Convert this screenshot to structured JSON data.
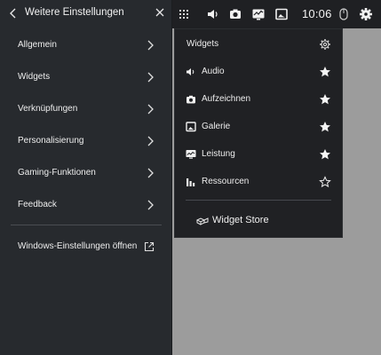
{
  "settings_panel": {
    "title": "Weitere Einstellungen",
    "items": [
      {
        "label": "Allgemein"
      },
      {
        "label": "Widgets"
      },
      {
        "label": "Verknüpfungen"
      },
      {
        "label": "Personalisierung"
      },
      {
        "label": "Gaming-Funktionen"
      },
      {
        "label": "Feedback"
      }
    ],
    "windows_link": "Windows-Einstellungen öffnen"
  },
  "topbar": {
    "clock": "10:06",
    "icons": [
      "grid-icon",
      "audio-icon",
      "camera-icon",
      "performance-icon",
      "gallery-icon",
      "mouse-icon",
      "gear-icon"
    ]
  },
  "widget_menu": {
    "header": "Widgets",
    "items": [
      {
        "label": "Audio",
        "icon": "speaker-icon",
        "favorite": true
      },
      {
        "label": "Aufzeichnen",
        "icon": "camera-icon",
        "favorite": true
      },
      {
        "label": "Galerie",
        "icon": "gallery-icon",
        "favorite": true
      },
      {
        "label": "Leistung",
        "icon": "performance-icon",
        "favorite": true
      },
      {
        "label": "Ressourcen",
        "icon": "resources-icon",
        "favorite": false
      }
    ],
    "store_label": "Widget Store"
  },
  "colors": {
    "panel_bg": "#272a2e",
    "menu_bg": "#202124",
    "topbar_bg": "#1f2023",
    "backdrop": "#9c9c9c",
    "text": "#f0f0f0"
  }
}
